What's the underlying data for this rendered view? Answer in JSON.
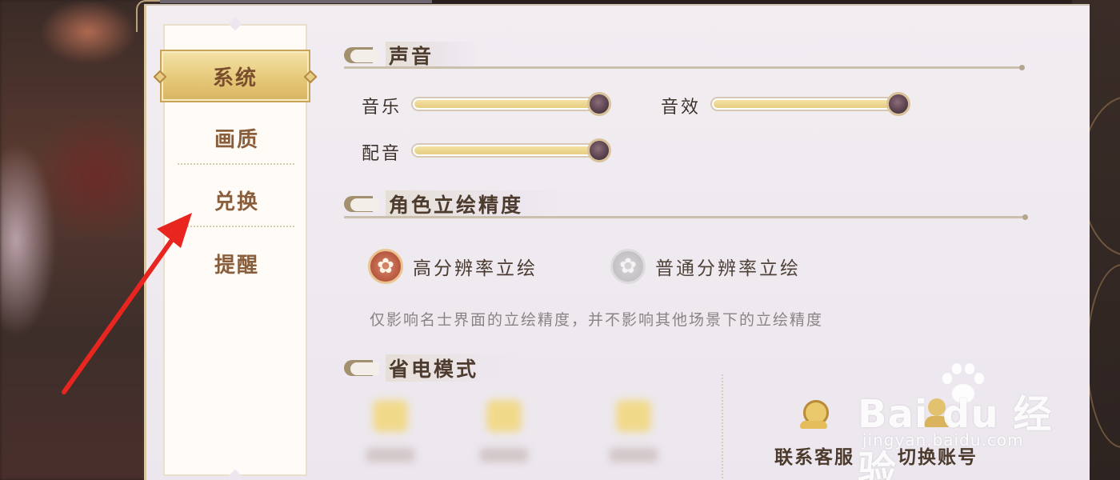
{
  "sidebar": {
    "tabs": [
      {
        "label": "系统",
        "active": true
      },
      {
        "label": "画质",
        "active": false
      },
      {
        "label": "兑换",
        "active": false
      },
      {
        "label": "提醒",
        "active": false
      }
    ]
  },
  "sound": {
    "title": "声音",
    "music": {
      "label": "音乐",
      "level": 0.93
    },
    "effects": {
      "label": "音效",
      "level": 0.93
    },
    "voice": {
      "label": "配音",
      "level": 0.93
    }
  },
  "portrait_quality": {
    "title": "角色立绘精度",
    "options": [
      {
        "label": "高分辨率立绘",
        "selected": true
      },
      {
        "label": "普通分辨率立绘",
        "selected": false
      }
    ],
    "hint": "仅影响名士界面的立绘精度，并不影响其他场景下的立绘精度"
  },
  "power_saving": {
    "title": "省电模式"
  },
  "actions": {
    "customer_service": "联系客服",
    "switch_account": "切换账号"
  },
  "watermark": {
    "brand": "Bai  du 经验",
    "url": "jingyan.baidu.com"
  },
  "colors": {
    "accent_gold": "#e6c97a",
    "tab_text": "#8a5d3b",
    "annotation_arrow": "#e8261f"
  }
}
